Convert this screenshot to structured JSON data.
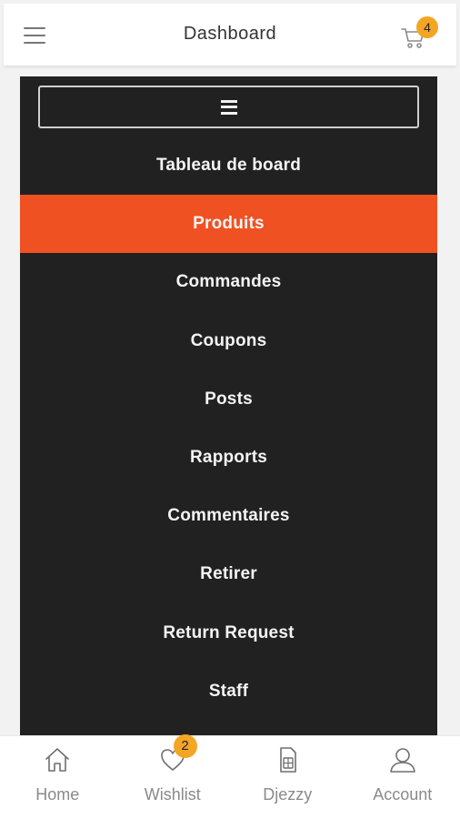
{
  "header": {
    "title": "Dashboard",
    "cart_count": "4",
    "menu_icon": "hamburger-icon",
    "cart_icon": "cart-icon"
  },
  "sidebar": {
    "toggle_icon": "hamburger-icon",
    "items": [
      {
        "label": "Tableau de board",
        "active": false
      },
      {
        "label": "Produits",
        "active": true
      },
      {
        "label": "Commandes",
        "active": false
      },
      {
        "label": "Coupons",
        "active": false
      },
      {
        "label": "Posts",
        "active": false
      },
      {
        "label": "Rapports",
        "active": false
      },
      {
        "label": "Commentaires",
        "active": false
      },
      {
        "label": "Retirer",
        "active": false
      },
      {
        "label": "Return Request",
        "active": false
      },
      {
        "label": "Staff",
        "active": false
      }
    ]
  },
  "bottom_nav": {
    "items": [
      {
        "label": "Home",
        "icon": "home-icon"
      },
      {
        "label": "Wishlist",
        "icon": "heart-icon",
        "badge": "2"
      },
      {
        "label": "Djezzy",
        "icon": "sim-card-icon"
      },
      {
        "label": "Account",
        "icon": "user-icon"
      }
    ]
  },
  "colors": {
    "accent": "#f05122",
    "badge": "#f5a524",
    "panel_bg": "#212121"
  }
}
